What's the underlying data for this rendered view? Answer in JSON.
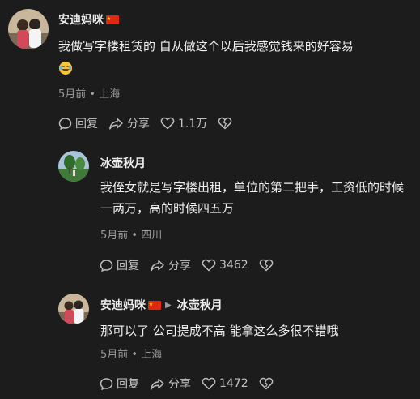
{
  "comments": [
    {
      "username": "安迪妈咪",
      "flag": "🇨🇳",
      "text": "我做写字楼租赁的 自从做这个以后我感觉钱来的好容易",
      "emoji": "rofl-emoji",
      "date": "5月前",
      "location": "上海",
      "reply_label": "回复",
      "share_label": "分享",
      "likes": "1.1万"
    },
    {
      "username": "冰壶秋月",
      "text": "我侄女就是写字楼出租，单位的第二把手，工资低的时候一两万，高的时候四五万",
      "date": "5月前",
      "location": "四川",
      "reply_label": "回复",
      "share_label": "分享",
      "likes": "3462"
    },
    {
      "username": "安迪妈咪",
      "flag": "🇨🇳",
      "reply_to": "冰壶秋月",
      "text": "那可以了 公司提成不高 能拿这么多很不错哦",
      "date": "5月前",
      "location": "上海",
      "reply_label": "回复",
      "share_label": "分享",
      "likes": "1472"
    }
  ],
  "meta_separator": "•",
  "colors": {
    "background": "#1c1c1c",
    "text": "#f0f0f0",
    "muted": "#9a9a9a"
  }
}
